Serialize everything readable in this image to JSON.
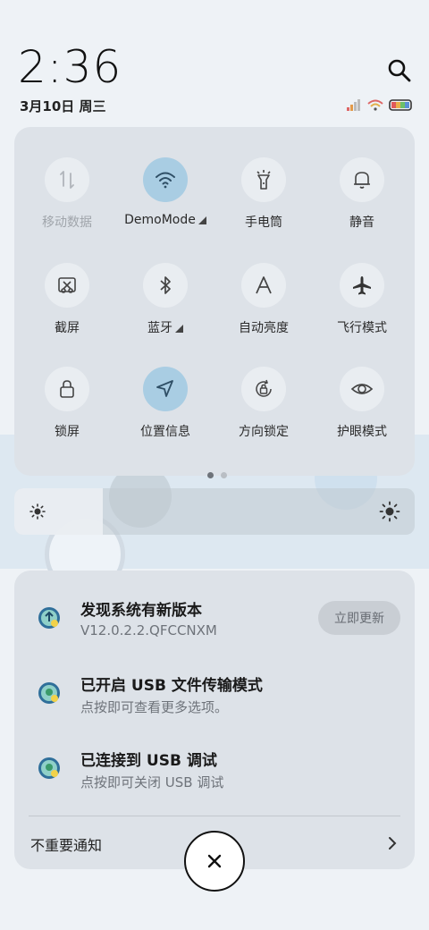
{
  "status": {
    "time": "2:36",
    "date": "3月10日 周三"
  },
  "quick_settings": {
    "tiles": [
      {
        "label": "移动数据",
        "icon": "mobile-data-icon",
        "active": false,
        "disabled": true
      },
      {
        "label": "DemoMode",
        "icon": "wifi-icon",
        "active": true,
        "caret": true
      },
      {
        "label": "手电筒",
        "icon": "flashlight-icon",
        "active": false
      },
      {
        "label": "静音",
        "icon": "bell-icon",
        "active": false
      },
      {
        "label": "截屏",
        "icon": "screenshot-icon",
        "active": false
      },
      {
        "label": "蓝牙",
        "icon": "bluetooth-icon",
        "active": false,
        "caret": true
      },
      {
        "label": "自动亮度",
        "icon": "auto-brightness-icon",
        "active": false
      },
      {
        "label": "飞行模式",
        "icon": "airplane-icon",
        "active": false
      },
      {
        "label": "锁屏",
        "icon": "lock-icon",
        "active": false
      },
      {
        "label": "位置信息",
        "icon": "location-icon",
        "active": true
      },
      {
        "label": "方向锁定",
        "icon": "rotation-lock-icon",
        "active": false
      },
      {
        "label": "护眼模式",
        "icon": "eye-icon",
        "active": false
      }
    ],
    "page_count": 2,
    "current_page": 1
  },
  "brightness": {
    "level": 0.22
  },
  "notifications": [
    {
      "title": "发现系统有新版本",
      "subtitle": "V12.0.2.2.QFCCNXM",
      "action": "立即更新",
      "icon": "system-update-icon"
    },
    {
      "title": "已开启 USB 文件传输模式",
      "subtitle": "点按即可查看更多选项。",
      "icon": "android-system-icon"
    },
    {
      "title": "已连接到 USB 调试",
      "subtitle": "点按即可关闭 USB 调试",
      "icon": "android-system-icon"
    }
  ],
  "footer": {
    "unimportant_label": "不重要通知"
  },
  "colors": {
    "active_tile": "#a9cde3",
    "panel": "#dde2e8",
    "accent_icon": "#2f6f9a"
  }
}
